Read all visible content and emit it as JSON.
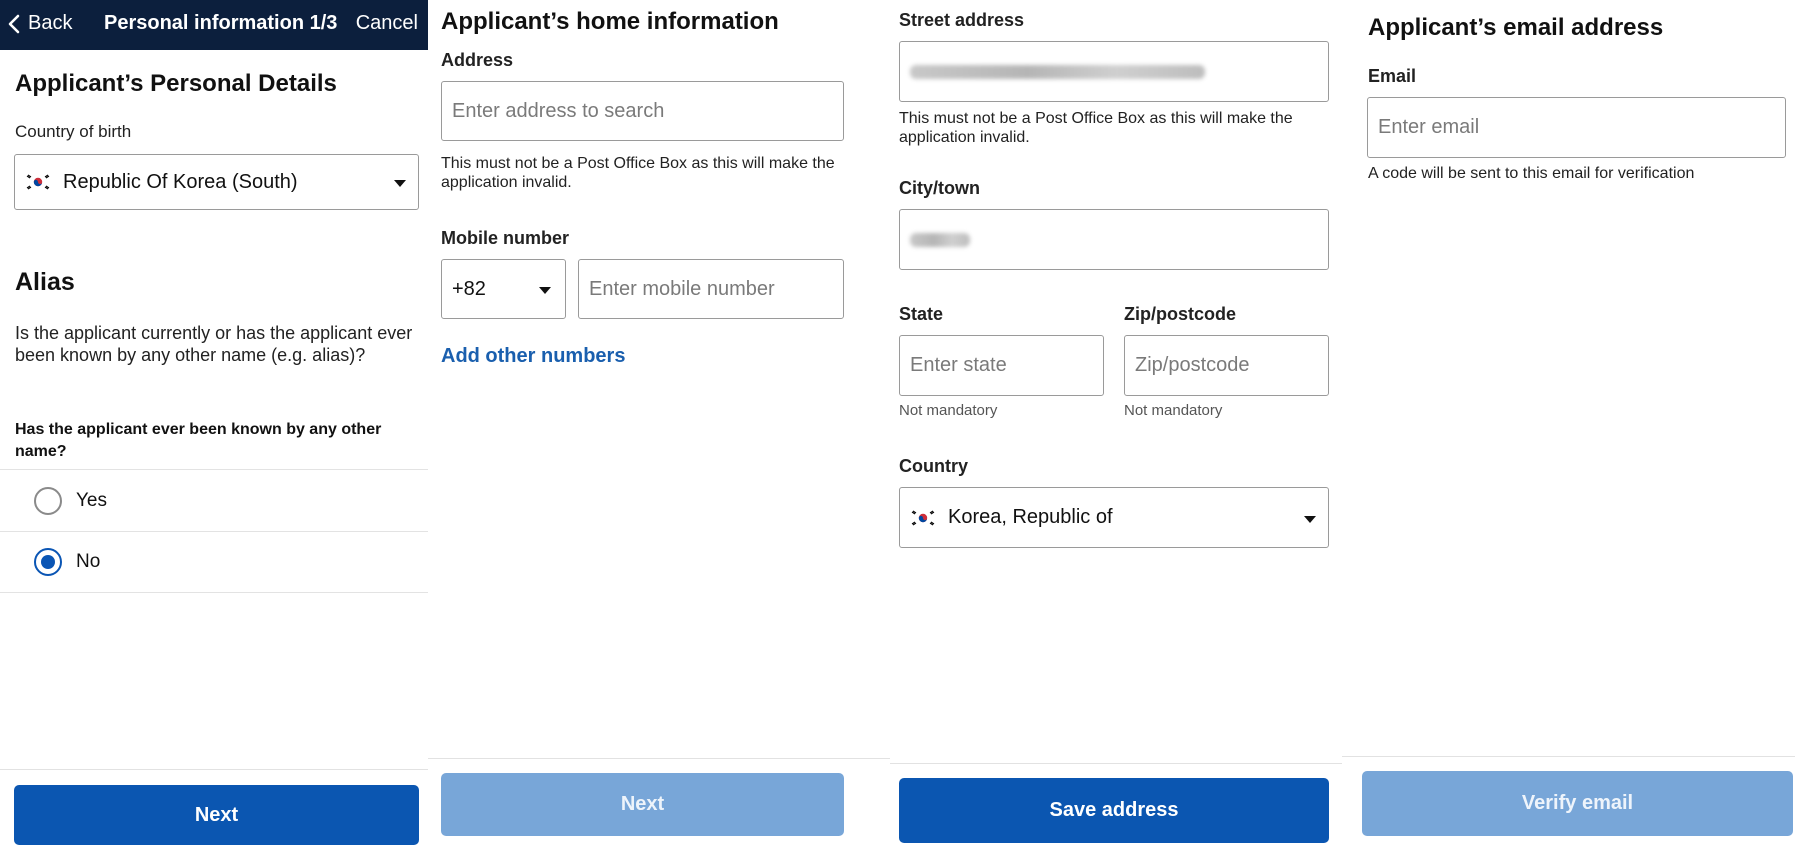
{
  "screen1": {
    "nav": {
      "back_label": "Back",
      "title": "Personal information 1/3",
      "cancel_label": "Cancel"
    },
    "heading": "Applicant’s Personal Details",
    "country_of_birth_label": "Country of birth",
    "country_of_birth_value": "Republic Of Korea (South)",
    "alias_heading": "Alias",
    "alias_question": "Is the applicant currently or has the applicant ever been known by any other name (e.g. alias)?",
    "alias_subquestion": "Has the applicant ever been known by any other name?",
    "options": [
      {
        "label": "Yes",
        "selected": false
      },
      {
        "label": "No",
        "selected": true
      }
    ],
    "next_label": "Next"
  },
  "screen2": {
    "heading": "Applicant’s home information",
    "address_label": "Address",
    "address_placeholder": "Enter address to search",
    "address_help": "This must not be a Post Office Box as this will make the application invalid.",
    "mobile_label": "Mobile number",
    "country_code": "+82",
    "mobile_placeholder": "Enter mobile number",
    "add_numbers_link": "Add other numbers",
    "next_label": "Next"
  },
  "screen3": {
    "street_label": "Street address",
    "street_help": "This must not be a Post Office Box as this will make the application invalid.",
    "city_label": "City/town",
    "state_label": "State",
    "state_placeholder": "Enter state",
    "state_note": "Not mandatory",
    "zip_label": "Zip/postcode",
    "zip_placeholder": "Zip/postcode",
    "zip_note": "Not mandatory",
    "country_label": "Country",
    "country_value": "Korea, Republic of",
    "save_label": "Save address"
  },
  "screen4": {
    "heading": "Applicant’s email address",
    "email_label": "Email",
    "email_placeholder": "Enter email",
    "email_help": "A code will be sent to this email for verification",
    "verify_label": "Verify email"
  },
  "colors": {
    "nav_bg": "#0c1f3d",
    "primary": "#0b56b1",
    "primary_disabled": "#78a6d8",
    "link": "#1a5fae"
  },
  "icons": [
    "chevron-left-icon",
    "korea-flag-icon",
    "dropdown-caret-icon"
  ]
}
